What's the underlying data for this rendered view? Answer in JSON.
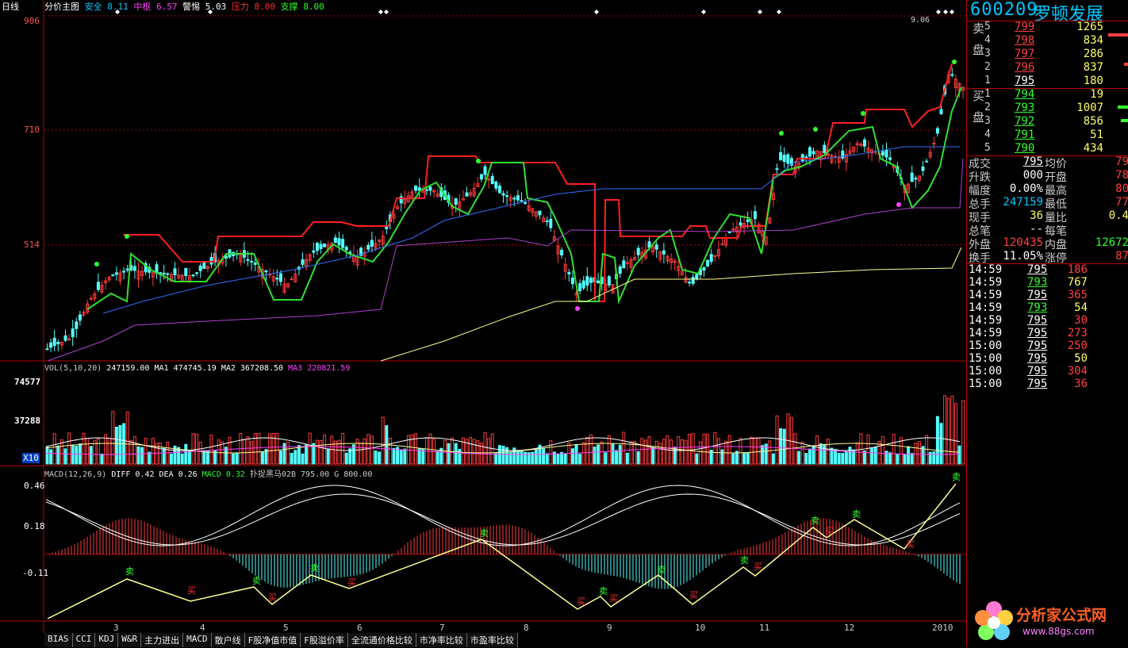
{
  "chart_label": "日线",
  "main_indicator": {
    "name": "分价主图",
    "items": [
      {
        "label": "安全",
        "value": "8.11",
        "color": "#00c8ff"
      },
      {
        "label": "中枢",
        "value": "6.57",
        "color": "#ff40ff"
      },
      {
        "label": "警惕",
        "value": "5.03",
        "color": "#ffffff"
      },
      {
        "label": "压力",
        "value": "8.00",
        "color": "#ff3030"
      },
      {
        "label": "支撑",
        "value": "8.00",
        "color": "#30ff30"
      }
    ],
    "y_ticks": [
      "906",
      "710",
      "514"
    ],
    "peak_label": "9.06"
  },
  "volume": {
    "legend": "VOL(5,10,20)",
    "vol": "247159.00",
    "ma1": "MA1 474745.19",
    "ma2": "MA2 367208.50",
    "ma3": "MA3 220821.59",
    "y_ticks": [
      "74577",
      "37288"
    ],
    "unit": "X10"
  },
  "macd": {
    "legend": "MACD(12,26,9)",
    "diff": "DIFF 0.42",
    "dea": "DEA 0.26",
    "macd": "MACD 0.32",
    "extra": "扑捉黑马02B 795.00 G 800.00",
    "y_ticks": [
      "0.46",
      "0.18",
      "-0.11"
    ],
    "buy_label": "买",
    "sell_label": "卖"
  },
  "x_axis": [
    "3",
    "4",
    "5",
    "6",
    "7",
    "8",
    "9",
    "10",
    "11",
    "12",
    "2010"
  ],
  "tabs": [
    "BIAS",
    "CCI",
    "KDJ",
    "W&R",
    "主力进出",
    "MACD",
    "散户线",
    "F股净值市值",
    "F股溢价率",
    "全流通价格比较",
    "市净率比较",
    "市盈率比较"
  ],
  "quote": {
    "code": "600209",
    "name": "罗顿发展",
    "sell_label": "卖盘",
    "buy_label": "买盘",
    "sell": [
      {
        "lvl": "5",
        "price": "799",
        "vol": "1265"
      },
      {
        "lvl": "4",
        "price": "798",
        "vol": "834"
      },
      {
        "lvl": "3",
        "price": "797",
        "vol": "286"
      },
      {
        "lvl": "2",
        "price": "796",
        "vol": "837"
      },
      {
        "lvl": "1",
        "price": "795",
        "vol": "180"
      }
    ],
    "buy": [
      {
        "lvl": "1",
        "price": "794",
        "vol": "19"
      },
      {
        "lvl": "2",
        "price": "793",
        "vol": "1007"
      },
      {
        "lvl": "3",
        "price": "792",
        "vol": "856"
      },
      {
        "lvl": "4",
        "price": "791",
        "vol": "51"
      },
      {
        "lvl": "5",
        "price": "790",
        "vol": "434"
      }
    ],
    "stats": [
      {
        "k1": "成交",
        "v1": "795",
        "k2": "均价",
        "v2": "79"
      },
      {
        "k1": "升跌",
        "v1": "000",
        "k2": "开盘",
        "v2": "78"
      },
      {
        "k1": "幅度",
        "v1": "0.00%",
        "k2": "最高",
        "v2": "80"
      },
      {
        "k1": "总手",
        "v1": "247159",
        "k2": "最低",
        "v2": "77"
      },
      {
        "k1": "现手",
        "v1": "36",
        "k2": "量比",
        "v2": "0.4"
      },
      {
        "k1": "总笔",
        "v1": "--",
        "k2": "每笔",
        "v2": ""
      },
      {
        "k1": "外盘",
        "v1": "120435",
        "k2": "内盘",
        "v2": "12672"
      },
      {
        "k1": "换手",
        "v1": "11.05%",
        "k2": "涨停",
        "v2": "87"
      }
    ],
    "ticks": [
      {
        "t": "14:59",
        "p": "795",
        "v": "186"
      },
      {
        "t": "14:59",
        "p": "793",
        "v": "767"
      },
      {
        "t": "14:59",
        "p": "795",
        "v": "365"
      },
      {
        "t": "14:59",
        "p": "793",
        "v": "54"
      },
      {
        "t": "14:59",
        "p": "795",
        "v": "30"
      },
      {
        "t": "14:59",
        "p": "795",
        "v": "273"
      },
      {
        "t": "15:00",
        "p": "795",
        "v": "250"
      },
      {
        "t": "15:00",
        "p": "795",
        "v": "50"
      },
      {
        "t": "15:00",
        "p": "795",
        "v": "304"
      },
      {
        "t": "15:00",
        "p": "795",
        "v": "36"
      }
    ]
  },
  "logo": {
    "text": "分析家公式网",
    "url": "www.88gs.com"
  },
  "colors": {
    "up": "#ff3b3b",
    "down": "#54ffff",
    "panel_border": "#b00000"
  }
}
